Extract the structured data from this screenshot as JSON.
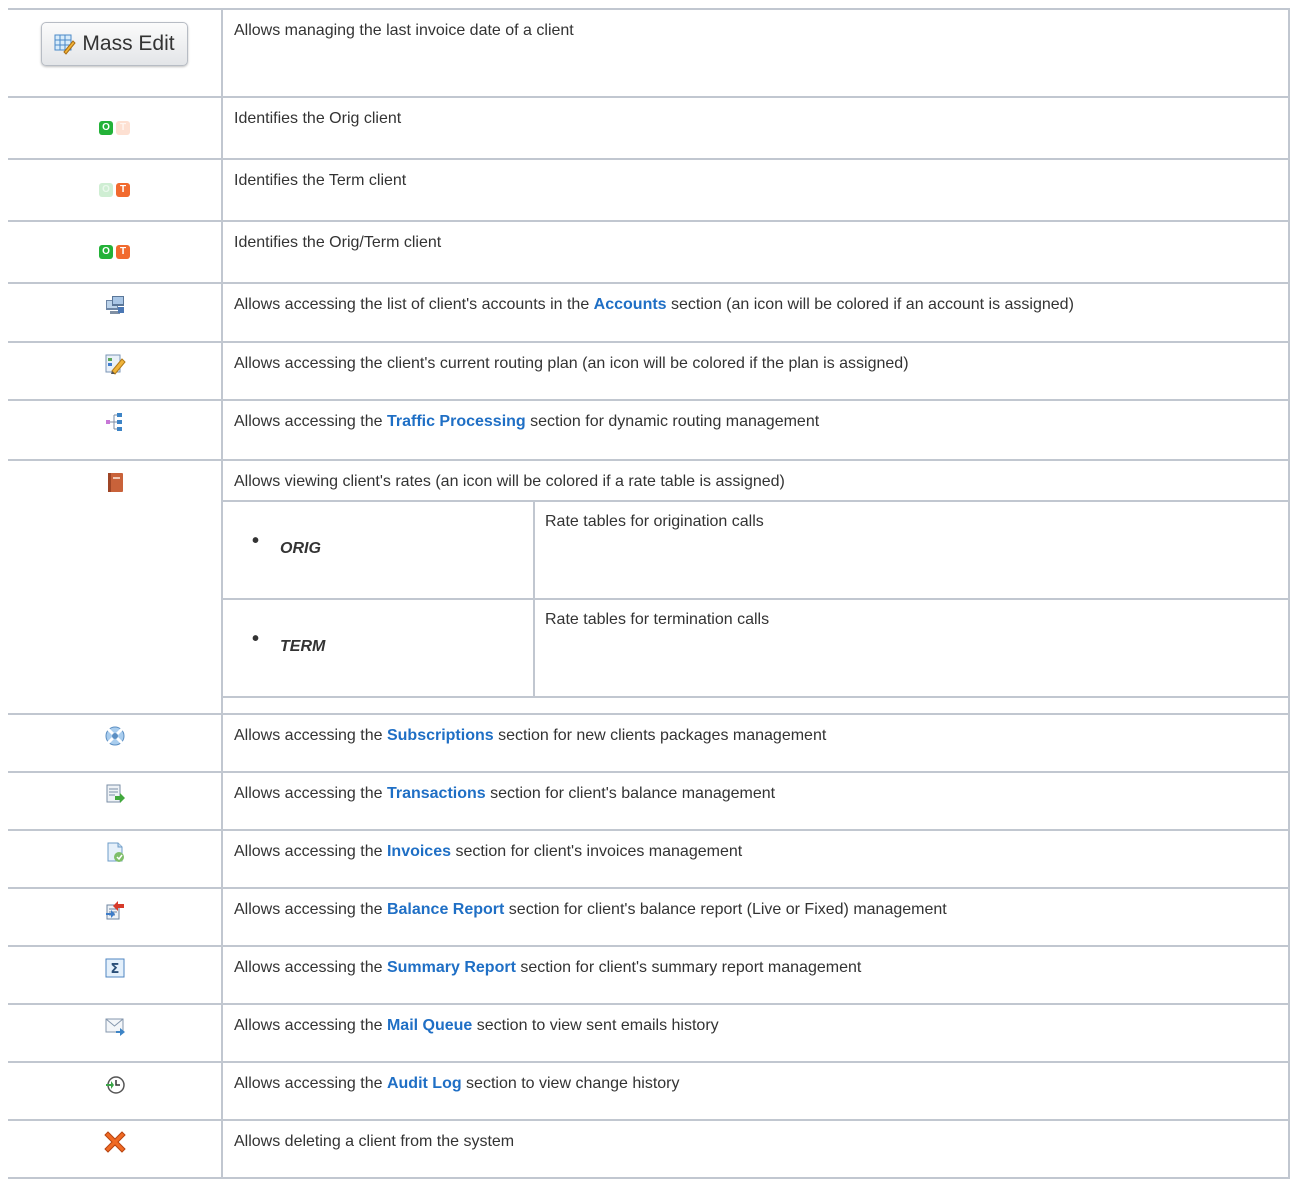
{
  "mass_edit": {
    "label": "Mass Edit",
    "icon": "table-edit-icon"
  },
  "rows": [
    {
      "icon": "mass-edit-button",
      "parts": [
        {
          "t": "Allows managing the last invoice date of a client"
        }
      ]
    },
    {
      "icon": "orig-client-icon",
      "parts": [
        {
          "t": "Identifies the Orig client"
        }
      ]
    },
    {
      "icon": "term-client-icon",
      "parts": [
        {
          "t": "Identifies the Term client"
        }
      ]
    },
    {
      "icon": "orig-term-client-icon",
      "parts": [
        {
          "t": "Identifies the Orig/Term client"
        }
      ]
    },
    {
      "icon": "accounts-icon",
      "parts": [
        {
          "t": "Allows accessing the list of client's accounts in the "
        },
        {
          "link": "Accounts"
        },
        {
          "t": " section (an icon will be colored if an account is assigned)"
        }
      ]
    },
    {
      "icon": "routing-plan-icon",
      "parts": [
        {
          "t": "Allows accessing the client's current routing plan (an icon will be colored if the plan is assigned)"
        }
      ]
    },
    {
      "icon": "traffic-processing-icon",
      "parts": [
        {
          "t": "Allows accessing the "
        },
        {
          "link": "Traffic Processing"
        },
        {
          "t": " section for dynamic routing management"
        }
      ]
    },
    {
      "icon": "rates-book-icon",
      "parts": [
        {
          "t": "Allows viewing client's rates (an icon will be colored if a rate table is assigned)"
        }
      ]
    },
    {
      "icon": "subscriptions-icon",
      "parts": [
        {
          "t": "Allows accessing the "
        },
        {
          "link": "Subscriptions"
        },
        {
          "t": " section for new clients packages management"
        }
      ]
    },
    {
      "icon": "transactions-icon",
      "parts": [
        {
          "t": "Allows accessing the "
        },
        {
          "link": "Transactions"
        },
        {
          "t": " section for client's balance management"
        }
      ]
    },
    {
      "icon": "invoices-icon",
      "parts": [
        {
          "t": "Allows accessing the "
        },
        {
          "link": "Invoices"
        },
        {
          "t": " section for client's invoices management"
        }
      ]
    },
    {
      "icon": "balance-report-icon",
      "parts": [
        {
          "t": "Allows accessing the "
        },
        {
          "link": "Balance Report"
        },
        {
          "t": " section for client's balance report (Live or Fixed) management"
        }
      ]
    },
    {
      "icon": "summary-report-icon",
      "parts": [
        {
          "t": "Allows accessing the "
        },
        {
          "link": "Summary Report"
        },
        {
          "t": " section for client's summary report management"
        }
      ]
    },
    {
      "icon": "mail-queue-icon",
      "parts": [
        {
          "t": "Allows accessing the "
        },
        {
          "link": "Mail Queue"
        },
        {
          "t": " section to view sent emails history"
        }
      ]
    },
    {
      "icon": "audit-log-icon",
      "parts": [
        {
          "t": "Allows accessing the "
        },
        {
          "link": "Audit Log"
        },
        {
          "t": " section to view change history"
        }
      ]
    },
    {
      "icon": "delete-icon",
      "parts": [
        {
          "t": "Allows deleting a client from the system"
        }
      ]
    }
  ],
  "rates": [
    {
      "name": "ORIG",
      "desc": "Rate tables for origination calls"
    },
    {
      "name": "TERM",
      "desc": "Rate tables for termination calls"
    }
  ],
  "ot_letters": {
    "o": "O",
    "t": "T"
  },
  "colors": {
    "link": "#1f6fc5",
    "border": "#c1c7d0",
    "text": "#333333"
  }
}
